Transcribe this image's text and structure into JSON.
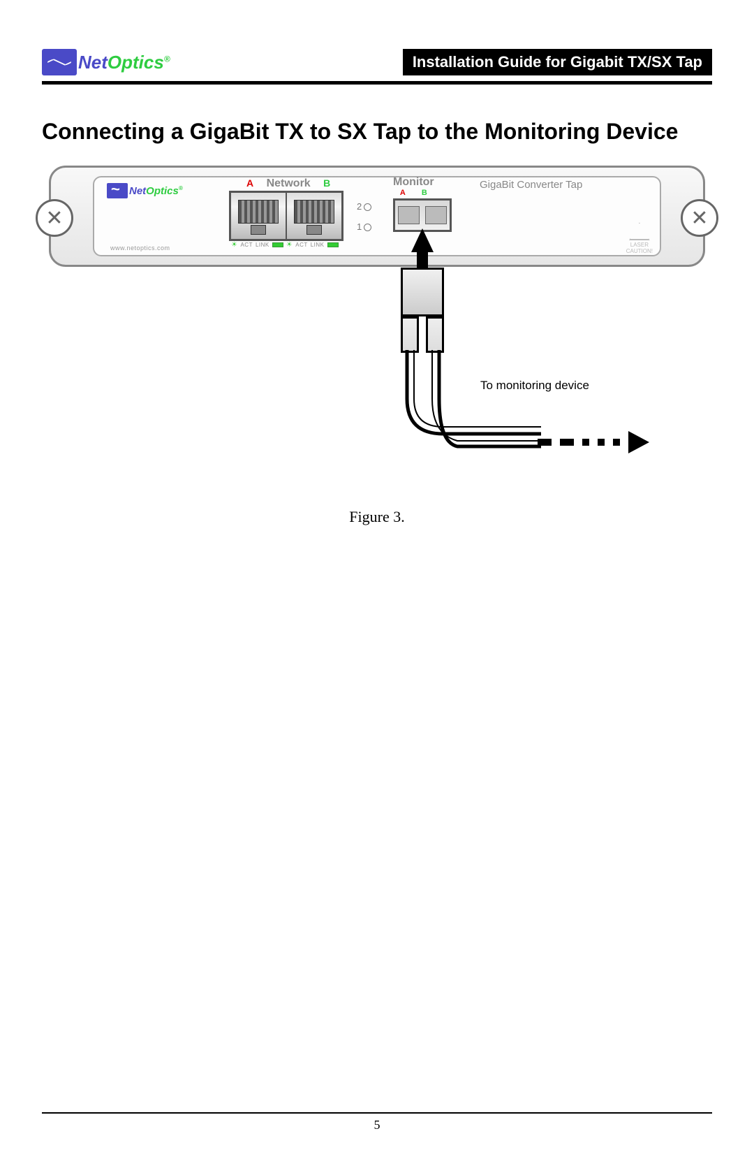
{
  "header": {
    "logo_net": "Net",
    "logo_optics": "Optics",
    "logo_reg": "®",
    "title": "Installation Guide for Gigabit TX/SX Tap"
  },
  "section_heading": "Connecting a GigaBit TX to SX Tap to the Monitoring Device",
  "device": {
    "panel_logo_net": "Net",
    "panel_logo_optics": "Optics",
    "panel_logo_reg": "®",
    "url": "www.netoptics.com",
    "network_a": "A",
    "network_label": "Network",
    "network_b": "B",
    "led_act": "ACT",
    "led_link": "LINK",
    "pwr_2": "2",
    "pwr_1": "1",
    "monitor_label": "Monitor",
    "monitor_a": "A",
    "monitor_b": "B",
    "product_label": "GigaBit Converter Tap",
    "laser_t1": "LASER",
    "laser_t2": "CAUTION!"
  },
  "cable_label": "To monitoring device",
  "figure_caption": "Figure 3.",
  "page_number": "5"
}
